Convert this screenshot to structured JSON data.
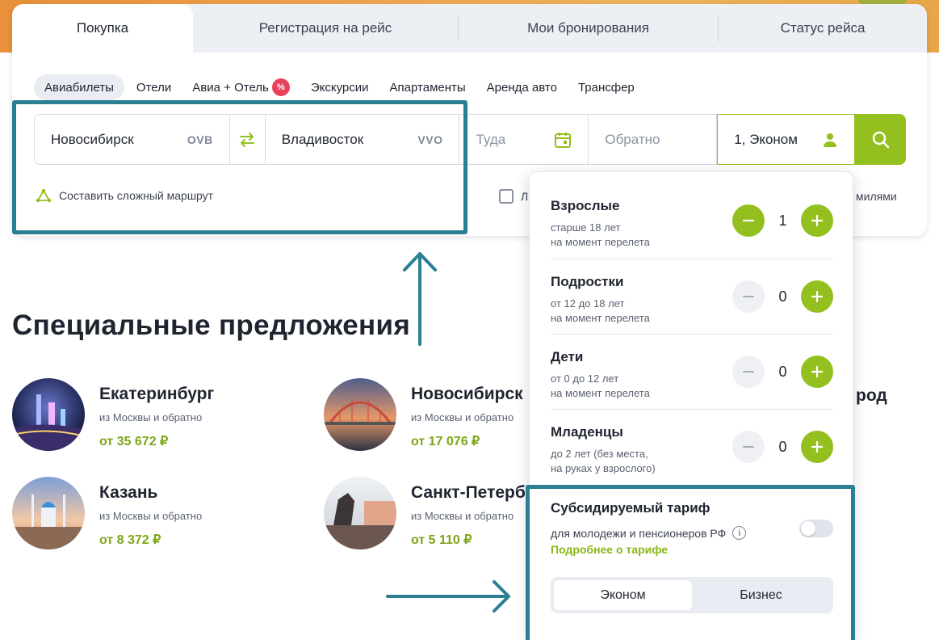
{
  "tabs": [
    "Покупка",
    "Регистрация на рейс",
    "Мои бронирования",
    "Статус рейса"
  ],
  "subtabs": [
    "Авиабилеты",
    "Отели",
    "Авиа + Отель",
    "Экскурсии",
    "Апартаменты",
    "Аренда авто",
    "Трансфер"
  ],
  "badge": "%",
  "search": {
    "from_city": "Новосибирск",
    "from_code": "OVB",
    "to_city": "Владивосток",
    "to_code": "VVO",
    "there_placeholder": "Туда",
    "back_placeholder": "Обратно",
    "passengers": "1, Эконом"
  },
  "route_link": "Составить сложный маршрут",
  "checkbox_label_partial": "Л",
  "miles_label_partial": "милями",
  "section_title": "Специальные предложения",
  "offers": [
    {
      "city": "Екатеринбург",
      "sub": "из Москвы и обратно",
      "price": "от 35 672 ₽"
    },
    {
      "city": "Новосибирск",
      "sub": "из Москвы и обратно",
      "price": "от 17 076 ₽"
    },
    {
      "city": "Казань",
      "sub": "из Москвы и обратно",
      "price": "от 8 372 ₽"
    },
    {
      "city": "Санкт-Петербург",
      "sub": "из Москвы и обратно",
      "price": "от 5 110 ₽"
    }
  ],
  "far_city_partial": "род",
  "passengers_popup": {
    "rows": [
      {
        "name": "Взрослые",
        "desc1": "старше 18 лет",
        "desc2": "на момент перелета",
        "count": "1"
      },
      {
        "name": "Подростки",
        "desc1": "от 12 до 18 лет",
        "desc2": "на момент перелета",
        "count": "0"
      },
      {
        "name": "Дети",
        "desc1": "от 0 до 12 лет",
        "desc2": "на момент перелета",
        "count": "0"
      },
      {
        "name": "Младенцы",
        "desc1": "до 2 лет (без места,",
        "desc2": "на руках у взрослого)",
        "count": "0"
      }
    ],
    "subsidy_title": "Субсидируемый тариф",
    "subsidy_desc": "для молодежи и пенсионеров РФ",
    "subsidy_link": "Подробнее о тарифе",
    "subsidy_enabled": false,
    "class_options": [
      "Эконом",
      "Бизнес"
    ],
    "class_selected": "Эконом"
  },
  "colors": {
    "accent": "#94c01f",
    "highlight": "#2a7f93",
    "price": "#7da616"
  }
}
